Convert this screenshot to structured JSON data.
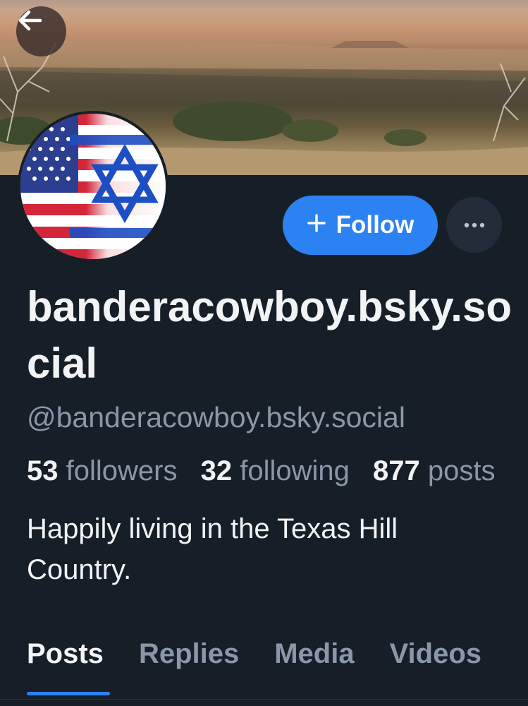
{
  "header": {
    "back_icon": "arrow-left-icon",
    "banner": "desert landscape photo"
  },
  "profile": {
    "avatar": "american-israeli-flag-avatar",
    "display_name": "banderacowboy.bsky.social",
    "handle": "@banderacowboy.bsky.social",
    "bio": "Happily living in the Texas Hill Country."
  },
  "actions": {
    "follow_label": "Follow",
    "follow_icon": "plus-icon",
    "more_icon": "ellipsis-icon",
    "accent_color": "#2c82f2"
  },
  "stats": {
    "followers_count": "53",
    "followers_label": "followers",
    "following_count": "32",
    "following_label": "following",
    "posts_count": "877",
    "posts_label": "posts"
  },
  "tabs": [
    {
      "label": "Posts",
      "active": true
    },
    {
      "label": "Replies",
      "active": false
    },
    {
      "label": "Media",
      "active": false
    },
    {
      "label": "Videos",
      "active": false
    }
  ]
}
